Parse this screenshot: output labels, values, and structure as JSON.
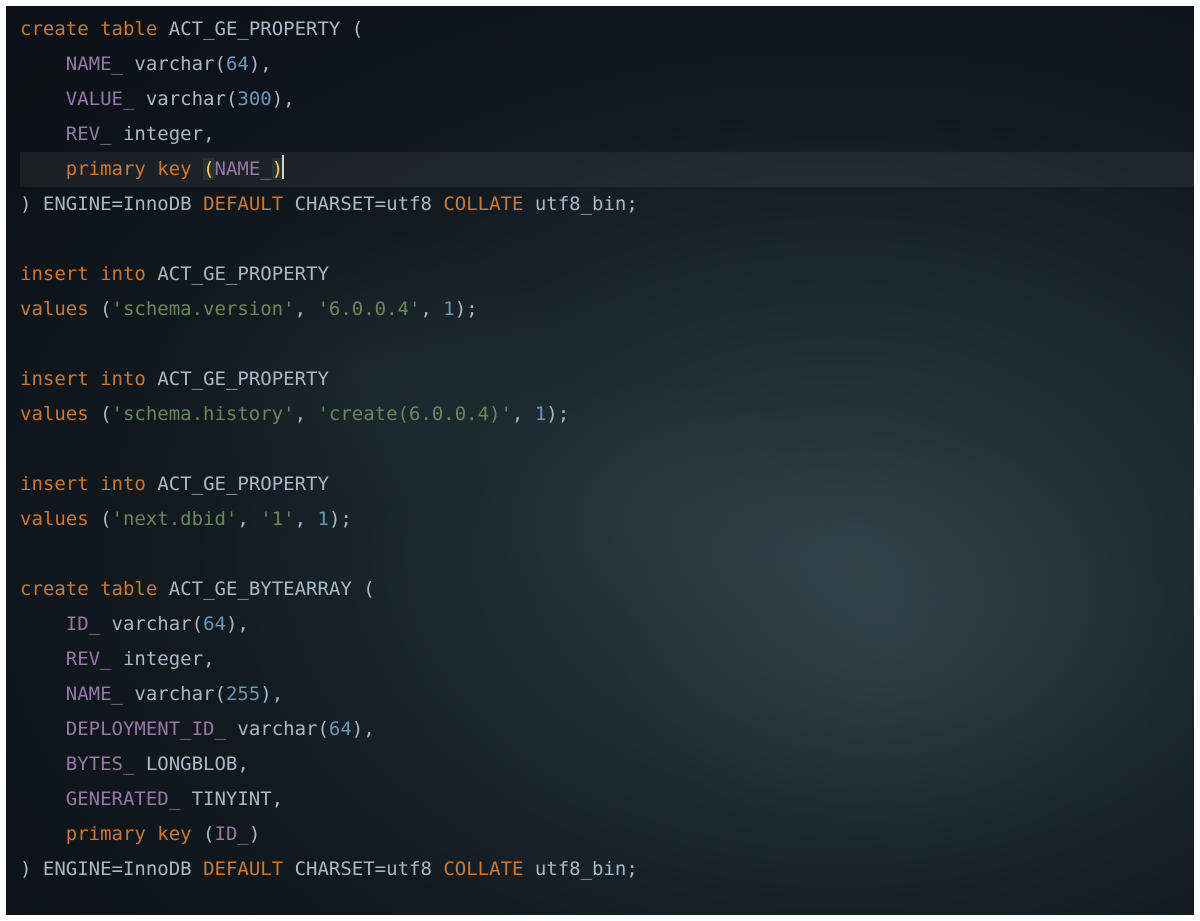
{
  "theme": {
    "keyword": "#cc7832",
    "identifier": "#a9b7c6",
    "column": "#9876aa",
    "number": "#6897bb",
    "string": "#6a8759",
    "highlight_paren": "#ffc66d",
    "current_line_bg": "rgba(255,255,255,0.055)"
  },
  "editor": {
    "cursor_line_index": 4,
    "lines": [
      {
        "tokens": [
          [
            "kw",
            "create"
          ],
          [
            "pn",
            " "
          ],
          [
            "kw",
            "table"
          ],
          [
            "pn",
            " "
          ],
          [
            "id",
            "ACT_GE_PROPERTY ("
          ]
        ]
      },
      {
        "tokens": [
          [
            "pn",
            "    "
          ],
          [
            "col",
            "NAME_"
          ],
          [
            "pn",
            " "
          ],
          [
            "type",
            "varchar"
          ],
          [
            "pn",
            "("
          ],
          [
            "num",
            "64"
          ],
          [
            "pn",
            "),"
          ]
        ]
      },
      {
        "tokens": [
          [
            "pn",
            "    "
          ],
          [
            "col",
            "VALUE_"
          ],
          [
            "pn",
            " "
          ],
          [
            "type",
            "varchar"
          ],
          [
            "pn",
            "("
          ],
          [
            "num",
            "300"
          ],
          [
            "pn",
            "),"
          ]
        ]
      },
      {
        "tokens": [
          [
            "pn",
            "    "
          ],
          [
            "col",
            "REV_"
          ],
          [
            "pn",
            " "
          ],
          [
            "type",
            "integer"
          ],
          [
            "pn",
            ","
          ]
        ]
      },
      {
        "highlight": true,
        "cursor_after": true,
        "tokens": [
          [
            "pn",
            "    "
          ],
          [
            "kw",
            "primary key"
          ],
          [
            "pn",
            " "
          ],
          [
            "hp",
            "("
          ],
          [
            "col",
            "NAME_"
          ],
          [
            "hp",
            ")"
          ]
        ]
      },
      {
        "tokens": [
          [
            "pn",
            ") "
          ],
          [
            "id",
            "ENGINE"
          ],
          [
            "pn",
            "="
          ],
          [
            "id",
            "InnoDB "
          ],
          [
            "kw",
            "DEFAULT"
          ],
          [
            "pn",
            " "
          ],
          [
            "id",
            "CHARSET"
          ],
          [
            "pn",
            "="
          ],
          [
            "id",
            "utf8 "
          ],
          [
            "kw",
            "COLLATE"
          ],
          [
            "pn",
            " "
          ],
          [
            "id",
            "utf8_bin;"
          ]
        ]
      },
      {
        "tokens": [
          [
            "pn",
            ""
          ]
        ]
      },
      {
        "tokens": [
          [
            "kw",
            "insert"
          ],
          [
            "pn",
            " "
          ],
          [
            "kw",
            "into"
          ],
          [
            "pn",
            " "
          ],
          [
            "id",
            "ACT_GE_PROPERTY"
          ]
        ]
      },
      {
        "tokens": [
          [
            "kw",
            "values"
          ],
          [
            "pn",
            " ("
          ],
          [
            "str",
            "'schema.version'"
          ],
          [
            "pn",
            ", "
          ],
          [
            "str",
            "'6.0.0.4'"
          ],
          [
            "pn",
            ", "
          ],
          [
            "num",
            "1"
          ],
          [
            "pn",
            ");"
          ]
        ]
      },
      {
        "tokens": [
          [
            "pn",
            ""
          ]
        ]
      },
      {
        "tokens": [
          [
            "kw",
            "insert"
          ],
          [
            "pn",
            " "
          ],
          [
            "kw",
            "into"
          ],
          [
            "pn",
            " "
          ],
          [
            "id",
            "ACT_GE_PROPERTY"
          ]
        ]
      },
      {
        "tokens": [
          [
            "kw",
            "values"
          ],
          [
            "pn",
            " ("
          ],
          [
            "str",
            "'schema.history'"
          ],
          [
            "pn",
            ", "
          ],
          [
            "str",
            "'create(6.0.0.4)'"
          ],
          [
            "pn",
            ", "
          ],
          [
            "num",
            "1"
          ],
          [
            "pn",
            ");"
          ]
        ]
      },
      {
        "tokens": [
          [
            "pn",
            ""
          ]
        ]
      },
      {
        "tokens": [
          [
            "kw",
            "insert"
          ],
          [
            "pn",
            " "
          ],
          [
            "kw",
            "into"
          ],
          [
            "pn",
            " "
          ],
          [
            "id",
            "ACT_GE_PROPERTY"
          ]
        ]
      },
      {
        "tokens": [
          [
            "kw",
            "values"
          ],
          [
            "pn",
            " ("
          ],
          [
            "str",
            "'next.dbid'"
          ],
          [
            "pn",
            ", "
          ],
          [
            "str",
            "'1'"
          ],
          [
            "pn",
            ", "
          ],
          [
            "num",
            "1"
          ],
          [
            "pn",
            ");"
          ]
        ]
      },
      {
        "tokens": [
          [
            "pn",
            ""
          ]
        ]
      },
      {
        "tokens": [
          [
            "kw",
            "create"
          ],
          [
            "pn",
            " "
          ],
          [
            "kw",
            "table"
          ],
          [
            "pn",
            " "
          ],
          [
            "id",
            "ACT_GE_BYTEARRAY ("
          ]
        ]
      },
      {
        "tokens": [
          [
            "pn",
            "    "
          ],
          [
            "col",
            "ID_"
          ],
          [
            "pn",
            " "
          ],
          [
            "type",
            "varchar"
          ],
          [
            "pn",
            "("
          ],
          [
            "num",
            "64"
          ],
          [
            "pn",
            "),"
          ]
        ]
      },
      {
        "tokens": [
          [
            "pn",
            "    "
          ],
          [
            "col",
            "REV_"
          ],
          [
            "pn",
            " "
          ],
          [
            "type",
            "integer"
          ],
          [
            "pn",
            ","
          ]
        ]
      },
      {
        "tokens": [
          [
            "pn",
            "    "
          ],
          [
            "col",
            "NAME_"
          ],
          [
            "pn",
            " "
          ],
          [
            "type",
            "varchar"
          ],
          [
            "pn",
            "("
          ],
          [
            "num",
            "255"
          ],
          [
            "pn",
            "),"
          ]
        ]
      },
      {
        "tokens": [
          [
            "pn",
            "    "
          ],
          [
            "col",
            "DEPLOYMENT_ID_"
          ],
          [
            "pn",
            " "
          ],
          [
            "type",
            "varchar"
          ],
          [
            "pn",
            "("
          ],
          [
            "num",
            "64"
          ],
          [
            "pn",
            "),"
          ]
        ]
      },
      {
        "tokens": [
          [
            "pn",
            "    "
          ],
          [
            "col",
            "BYTES_"
          ],
          [
            "pn",
            " "
          ],
          [
            "id",
            "LONGBLOB,"
          ]
        ]
      },
      {
        "tokens": [
          [
            "pn",
            "    "
          ],
          [
            "col",
            "GENERATED_"
          ],
          [
            "pn",
            " "
          ],
          [
            "id",
            "TINYINT,"
          ]
        ]
      },
      {
        "tokens": [
          [
            "pn",
            "    "
          ],
          [
            "kw",
            "primary key"
          ],
          [
            "pn",
            " ("
          ],
          [
            "col",
            "ID_"
          ],
          [
            "pn",
            ")"
          ]
        ]
      },
      {
        "tokens": [
          [
            "pn",
            ") "
          ],
          [
            "id",
            "ENGINE"
          ],
          [
            "pn",
            "="
          ],
          [
            "id",
            "InnoDB "
          ],
          [
            "kw",
            "DEFAULT"
          ],
          [
            "pn",
            " "
          ],
          [
            "id",
            "CHARSET"
          ],
          [
            "pn",
            "="
          ],
          [
            "id",
            "utf8 "
          ],
          [
            "kw",
            "COLLATE"
          ],
          [
            "pn",
            " "
          ],
          [
            "id",
            "utf8_bin;"
          ]
        ]
      }
    ]
  }
}
